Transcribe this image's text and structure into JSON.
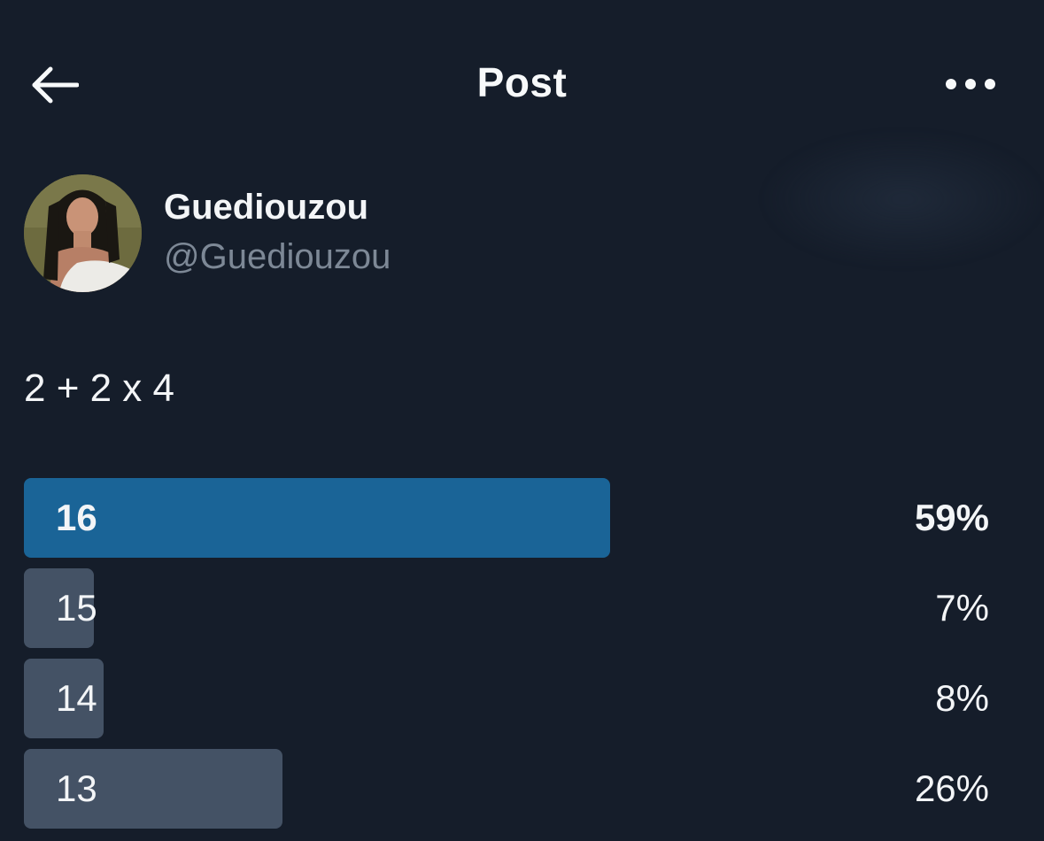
{
  "header": {
    "title": "Post",
    "back_icon": "arrow-left-icon",
    "more_icon": "more-horizontal-icon"
  },
  "author": {
    "display_name": "Guediouzou",
    "handle": "@Guediouzou"
  },
  "post": {
    "text": "2 + 2 x 4"
  },
  "poll": {
    "options": [
      {
        "label": "16",
        "percent_label": "59%",
        "percent": 59,
        "winner": true
      },
      {
        "label": "15",
        "percent_label": "7%",
        "percent": 7,
        "winner": false
      },
      {
        "label": "14",
        "percent_label": "8%",
        "percent": 8,
        "winner": false
      },
      {
        "label": "13",
        "percent_label": "26%",
        "percent": 26,
        "winner": false
      }
    ]
  },
  "colors": {
    "background": "#151d2a",
    "winner_bar": "#1a6497",
    "other_bar": "#445265",
    "secondary_text": "#7d8896"
  }
}
